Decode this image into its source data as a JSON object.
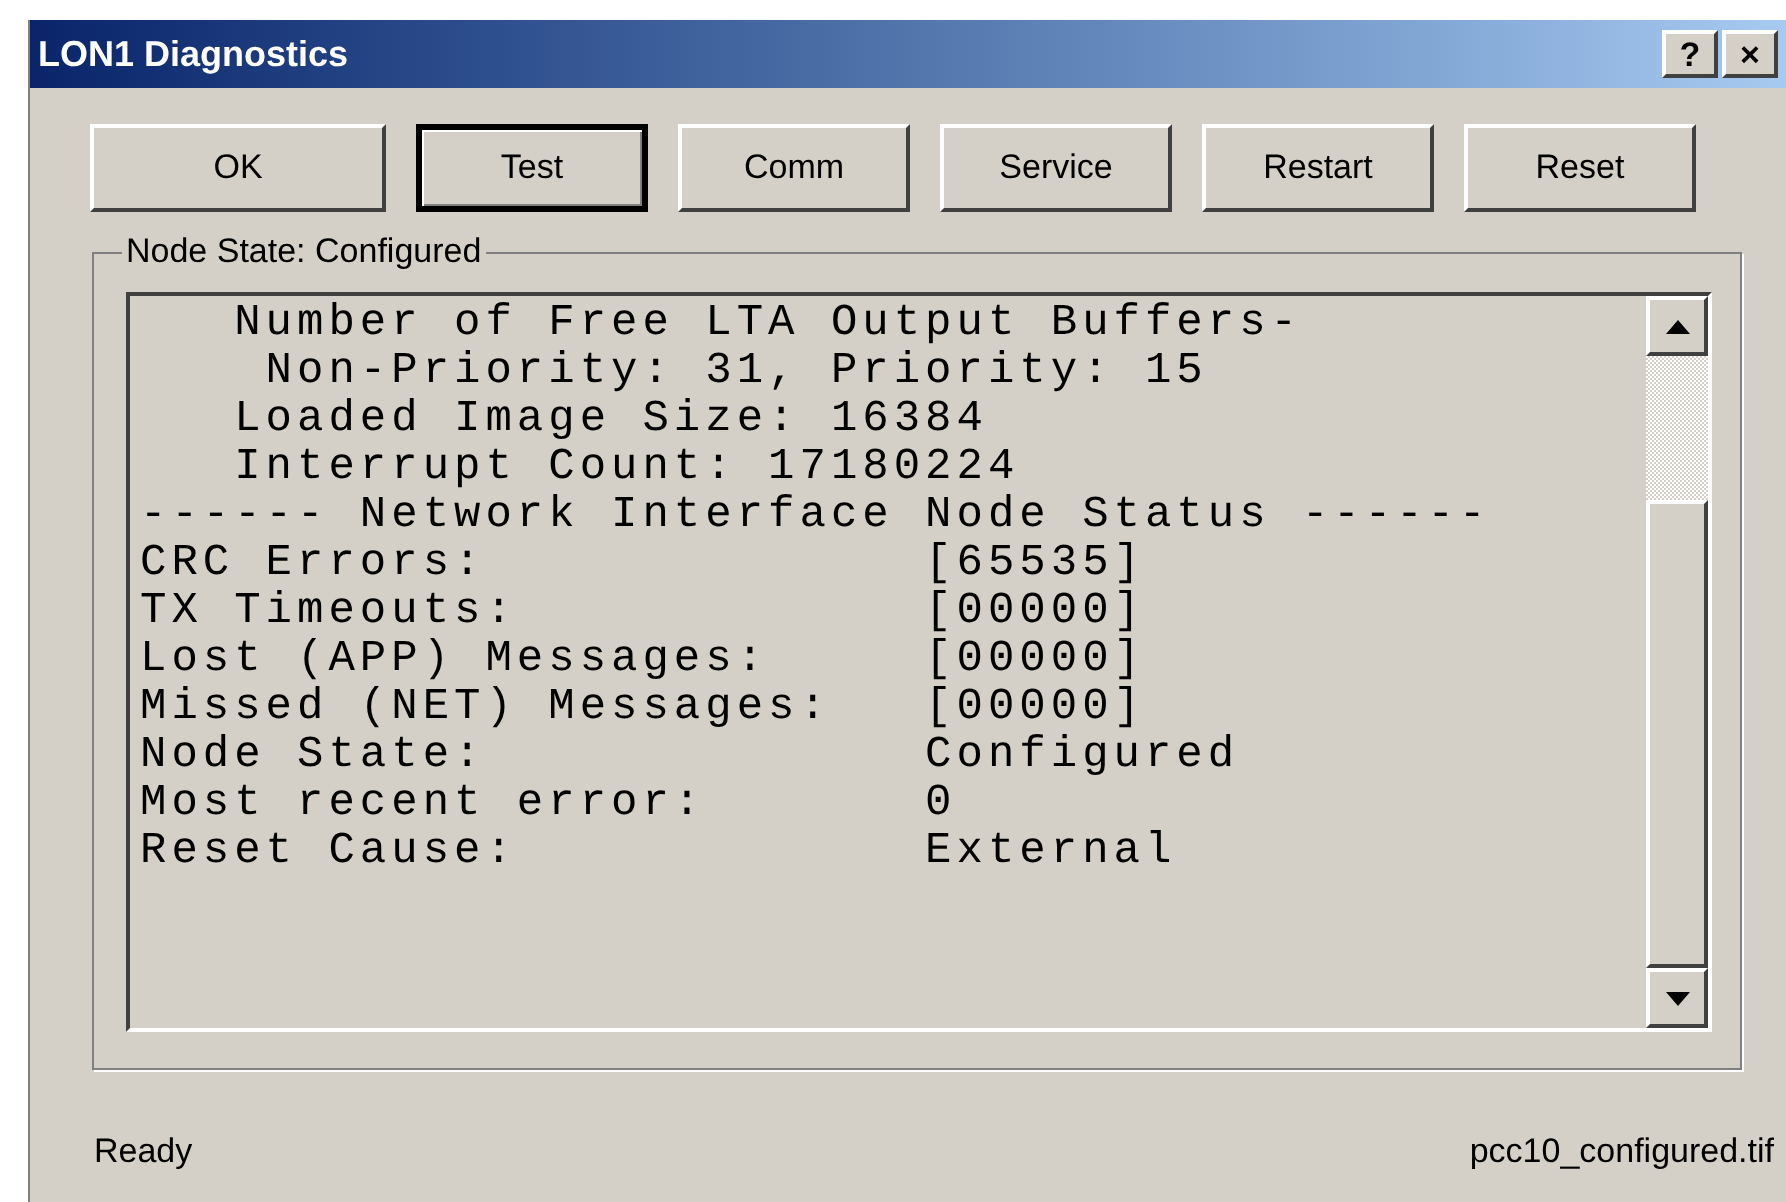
{
  "window": {
    "title": "LON1 Diagnostics",
    "controls": [
      "?",
      "×"
    ]
  },
  "buttons": [
    {
      "label": "OK",
      "default": false
    },
    {
      "label": "Test",
      "default": true
    },
    {
      "label": "Comm",
      "default": false
    },
    {
      "label": "Service",
      "default": false
    },
    {
      "label": "Restart",
      "default": false
    },
    {
      "label": "Reset",
      "default": false
    }
  ],
  "group": {
    "label": "Node State: Configured",
    "lines": [
      "   Number of Free LTA Output Buffers-",
      "    Non-Priority: 31, Priority: 15",
      "   Loaded Image Size: 16384",
      "   Interrupt Count: 17180224",
      "------ Network Interface Node Status ------",
      "CRC Errors:              [65535]",
      "TX Timeouts:             [00000]",
      "Lost (APP) Messages:     [00000]",
      "Missed (NET) Messages:   [00000]",
      "Node State:              Configured",
      "Most recent error:       0",
      "Reset Cause:             External"
    ]
  },
  "status_bar": {
    "text": "Ready",
    "file": "pcc10_configured.tif"
  }
}
